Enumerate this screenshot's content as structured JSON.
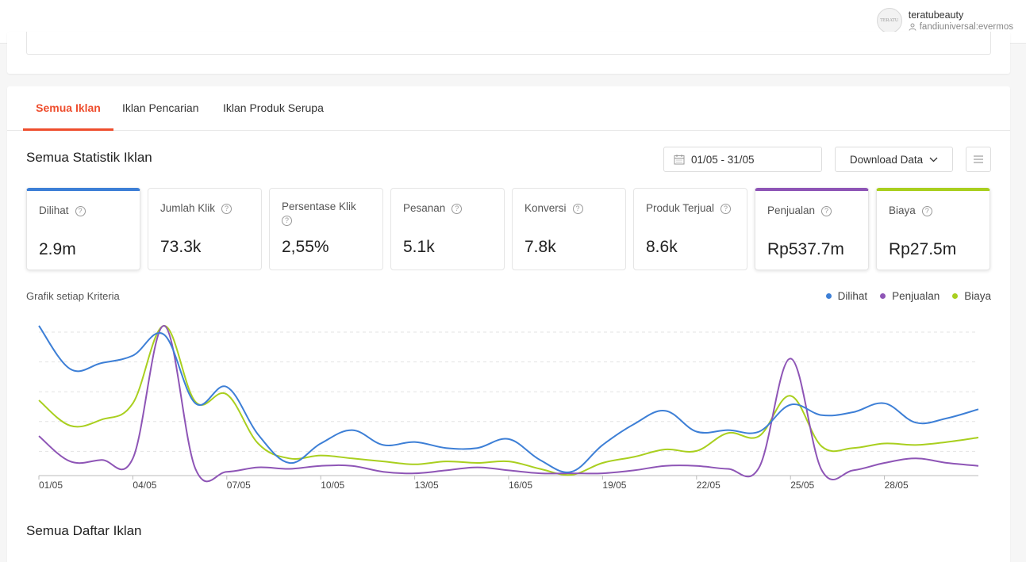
{
  "account": {
    "avatar_text": "TERATU",
    "name": "teratubeauty",
    "sub": "fandiuniversal:evermos"
  },
  "tabs": [
    {
      "label": "Semua Iklan",
      "active": true
    },
    {
      "label": "Iklan Pencarian",
      "active": false
    },
    {
      "label": "Iklan Produk Serupa",
      "active": false
    }
  ],
  "stats": {
    "title": "Semua Statistik Iklan",
    "date_range": "01/05 - 31/05",
    "download_label": "Download Data"
  },
  "metrics": [
    {
      "label": "Dilihat",
      "value": "2.9m",
      "selected": true,
      "color": "#3d7fd6"
    },
    {
      "label": "Jumlah Klik",
      "value": "73.3k",
      "selected": false
    },
    {
      "label": "Persentase Klik",
      "value": "2,55%",
      "selected": false
    },
    {
      "label": "Pesanan",
      "value": "5.1k",
      "selected": false
    },
    {
      "label": "Konversi",
      "value": "7.8k",
      "selected": false
    },
    {
      "label": "Produk Terjual",
      "value": "8.6k",
      "selected": false
    },
    {
      "label": "Penjualan",
      "value": "Rp537.7m",
      "selected": true,
      "color": "#8e55b6"
    },
    {
      "label": "Biaya",
      "value": "Rp27.5m",
      "selected": true,
      "color": "#a9cf1f"
    }
  ],
  "chart_title": "Grafik setiap Kriteria",
  "list_title": "Semua Daftar Iklan",
  "chart_data": {
    "type": "line",
    "x": [
      "01/05",
      "02/05",
      "03/05",
      "04/05",
      "05/05",
      "06/05",
      "07/05",
      "08/05",
      "09/05",
      "10/05",
      "11/05",
      "12/05",
      "13/05",
      "14/05",
      "15/05",
      "16/05",
      "17/05",
      "18/05",
      "19/05",
      "20/05",
      "21/05",
      "22/05",
      "23/05",
      "24/05",
      "25/05",
      "26/05",
      "27/05",
      "28/05",
      "29/05",
      "30/05",
      "31/05"
    ],
    "x_ticks": [
      "01/05",
      "04/05",
      "07/05",
      "10/05",
      "13/05",
      "16/05",
      "19/05",
      "22/05",
      "25/05",
      "28/05"
    ],
    "grid": true,
    "legend_position": "top-right",
    "series": [
      {
        "name": "Dilihat",
        "color": "#3d7fd6",
        "values": [
          100,
          71,
          75,
          80,
          94,
          48,
          59,
          27,
          8,
          21,
          30,
          20,
          22,
          18,
          18,
          24,
          10,
          2,
          20,
          34,
          43,
          29,
          30,
          29,
          47,
          40,
          42,
          48,
          35,
          38,
          44
        ]
      },
      {
        "name": "Penjualan",
        "color": "#8e55b6",
        "values": [
          26,
          9,
          10,
          11,
          100,
          4,
          2,
          5,
          4,
          6,
          6,
          2,
          1,
          3,
          5,
          3,
          1,
          1,
          1,
          3,
          6,
          6,
          4,
          5,
          78,
          3,
          3,
          8,
          11,
          8,
          6
        ]
      },
      {
        "name": "Biaya",
        "color": "#a9cf1f",
        "values": [
          50,
          33,
          37,
          48,
          100,
          49,
          54,
          21,
          11,
          13,
          11,
          9,
          7,
          9,
          8,
          9,
          4,
          0,
          8,
          12,
          17,
          16,
          28,
          26,
          53,
          19,
          18,
          21,
          20,
          22,
          25
        ]
      }
    ]
  }
}
